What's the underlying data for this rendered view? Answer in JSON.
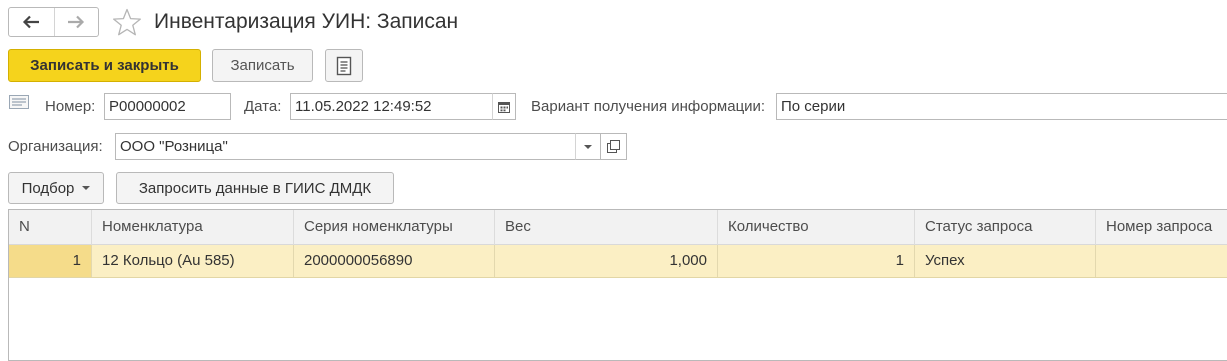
{
  "window": {
    "title": "Инвентаризация УИН: Записан"
  },
  "commands": {
    "save_close_label": "Записать и закрыть",
    "save_label": "Записать"
  },
  "form": {
    "number_label": "Номер:",
    "number_value": "Р00000002",
    "date_label": "Дата:",
    "date_value": "11.05.2022 12:49:52",
    "variant_label": "Вариант получения информации:",
    "variant_value": "По серии",
    "org_label": "Организация:",
    "org_value": "ООО \"Розница\""
  },
  "table_toolbar": {
    "select_label": "Подбор",
    "request_label": "Запросить данные в ГИИС ДМДК"
  },
  "table": {
    "columns": [
      "N",
      "Номенклатура",
      "Серия номенклатуры",
      "Вес",
      "Количество",
      "Статус запроса",
      "Номер запроса"
    ],
    "rows": [
      {
        "n": "1",
        "item": "12 Кольцо (Au 585)",
        "series": "2000000056890",
        "weight": "1,000",
        "qty": "1",
        "status": "Успех",
        "request_no": ""
      }
    ]
  },
  "colors": {
    "primary_button": "#f5d31c",
    "selected_row": "#fbefc4",
    "header_bg": "#f2f2f2"
  }
}
